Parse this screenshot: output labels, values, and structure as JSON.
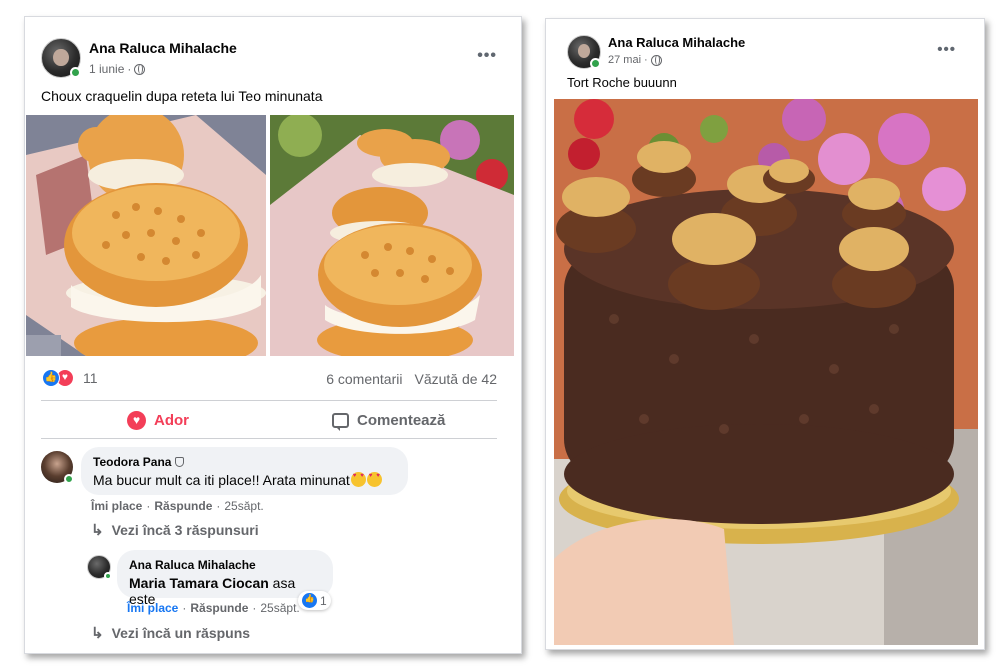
{
  "post1": {
    "author": "Ana Raluca Mihalache",
    "date": "1 iunie",
    "more_label": "•••",
    "text": "Choux craquelin dupa reteta lui Teo minunata",
    "reactions_count": "11",
    "comments_count": "6 comentarii",
    "views": "Văzută de 42",
    "action_love": "Ador",
    "action_comment": "Comentează",
    "comments": [
      {
        "author": "Teodora Pana",
        "text": "Ma bucur mult ca iti place!! Arata minunat",
        "like": "Îmi place",
        "reply": "Răspunde",
        "time": "25săpt.",
        "view_more": "Vezi încă 3 răspunsuri"
      },
      {
        "author": "Ana Raluca Mihalache",
        "mention": "Maria Tamara Ciocan",
        "text": " asa este",
        "like": "Îmi place",
        "reply": "Răspunde",
        "time": "25săpt.",
        "reaction_count": "1",
        "view_more": "Vezi încă un răspuns"
      }
    ]
  },
  "post2": {
    "author": "Ana Raluca Mihalache",
    "date": "27 mai",
    "more_label": "•••",
    "text": "Tort Roche buuunn"
  },
  "colors": {
    "accent_blue": "#1877f2",
    "love_red": "#f33e58",
    "online_green": "#31a24c",
    "muted": "#65676b"
  }
}
